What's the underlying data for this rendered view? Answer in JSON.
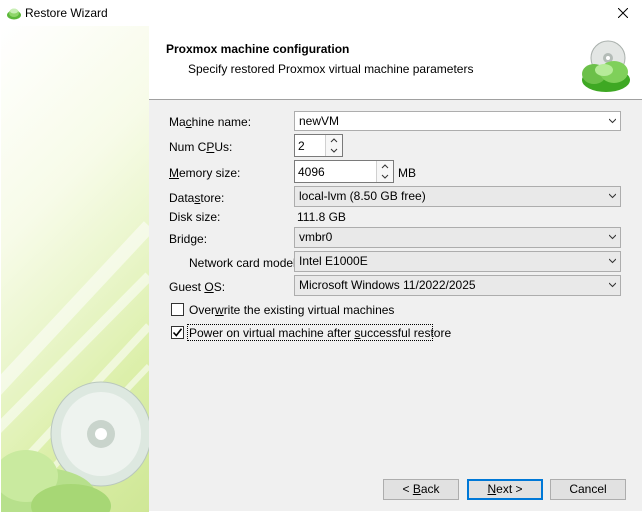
{
  "window": {
    "title": "Restore Wizard"
  },
  "header": {
    "title": "Proxmox machine configuration",
    "subtitle": "Specify restored Proxmox virtual machine parameters"
  },
  "form": {
    "machine_name": {
      "label_pre": "Ma",
      "label_u": "c",
      "label_post": "hine name:",
      "value": "newVM"
    },
    "num_cpus": {
      "label_pre": "Num C",
      "label_u": "P",
      "label_post": "Us:",
      "value": "2"
    },
    "memory_size": {
      "label_pre": "",
      "label_u": "M",
      "label_post": "emory size:",
      "value": "4096",
      "unit": "MB"
    },
    "datastore": {
      "label_pre": "Data",
      "label_u": "s",
      "label_post": "tore:",
      "value": "local-lvm (8.50 GB free)"
    },
    "disk_size": {
      "label": "Disk size:",
      "value": "111.8 GB"
    },
    "bridge": {
      "label_pre": "Brid",
      "label_u": "g",
      "label_post": "e:",
      "value": "vmbr0"
    },
    "network_card_model": {
      "label": "Network card model:",
      "value": "Intel E1000E"
    },
    "guest_os": {
      "label_pre": "Guest ",
      "label_u": "O",
      "label_post": "S:",
      "value": "Microsoft Windows 11/2022/2025"
    },
    "overwrite": {
      "label_pre": "Over",
      "label_u": "w",
      "label_post": "rite the existing virtual machines",
      "checked": false
    },
    "power_on": {
      "label_pre": "Power on virtual machine after ",
      "label_u": "s",
      "label_post": "uccessful restore",
      "checked": true
    }
  },
  "buttons": {
    "back": {
      "pre": "< ",
      "u": "B",
      "post": "ack"
    },
    "next": {
      "pre": "",
      "u": "N",
      "post": "ext >"
    },
    "cancel": "Cancel"
  },
  "icons": {
    "title": "disc-cloud-icon",
    "header_logo": "disc-cloud-logo-icon",
    "sidebar_art": "disc-watermark-icon"
  },
  "colors": {
    "accent": "#0078d7",
    "brand_green": "#6cc04a"
  }
}
